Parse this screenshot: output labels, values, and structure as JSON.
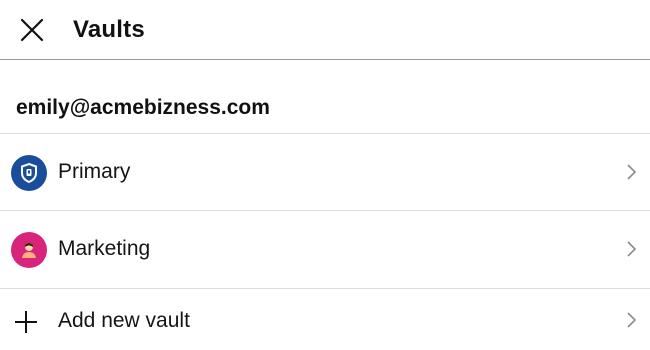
{
  "header": {
    "close_icon": "close-icon",
    "title": "Vaults"
  },
  "account": {
    "email": "emily@acmebizness.com"
  },
  "vaults": [
    {
      "label": "Primary",
      "icon": "shield-key-icon",
      "color": "#1a4d9c"
    },
    {
      "label": "Marketing",
      "icon": "person-icon",
      "color": "#d8247a"
    }
  ],
  "add_vault": {
    "label": "Add new vault",
    "icon": "plus-icon"
  },
  "colors": {
    "divider": "#dcdcdc",
    "header_border": "#9a9a9a",
    "chevron": "#8a8a8a"
  }
}
